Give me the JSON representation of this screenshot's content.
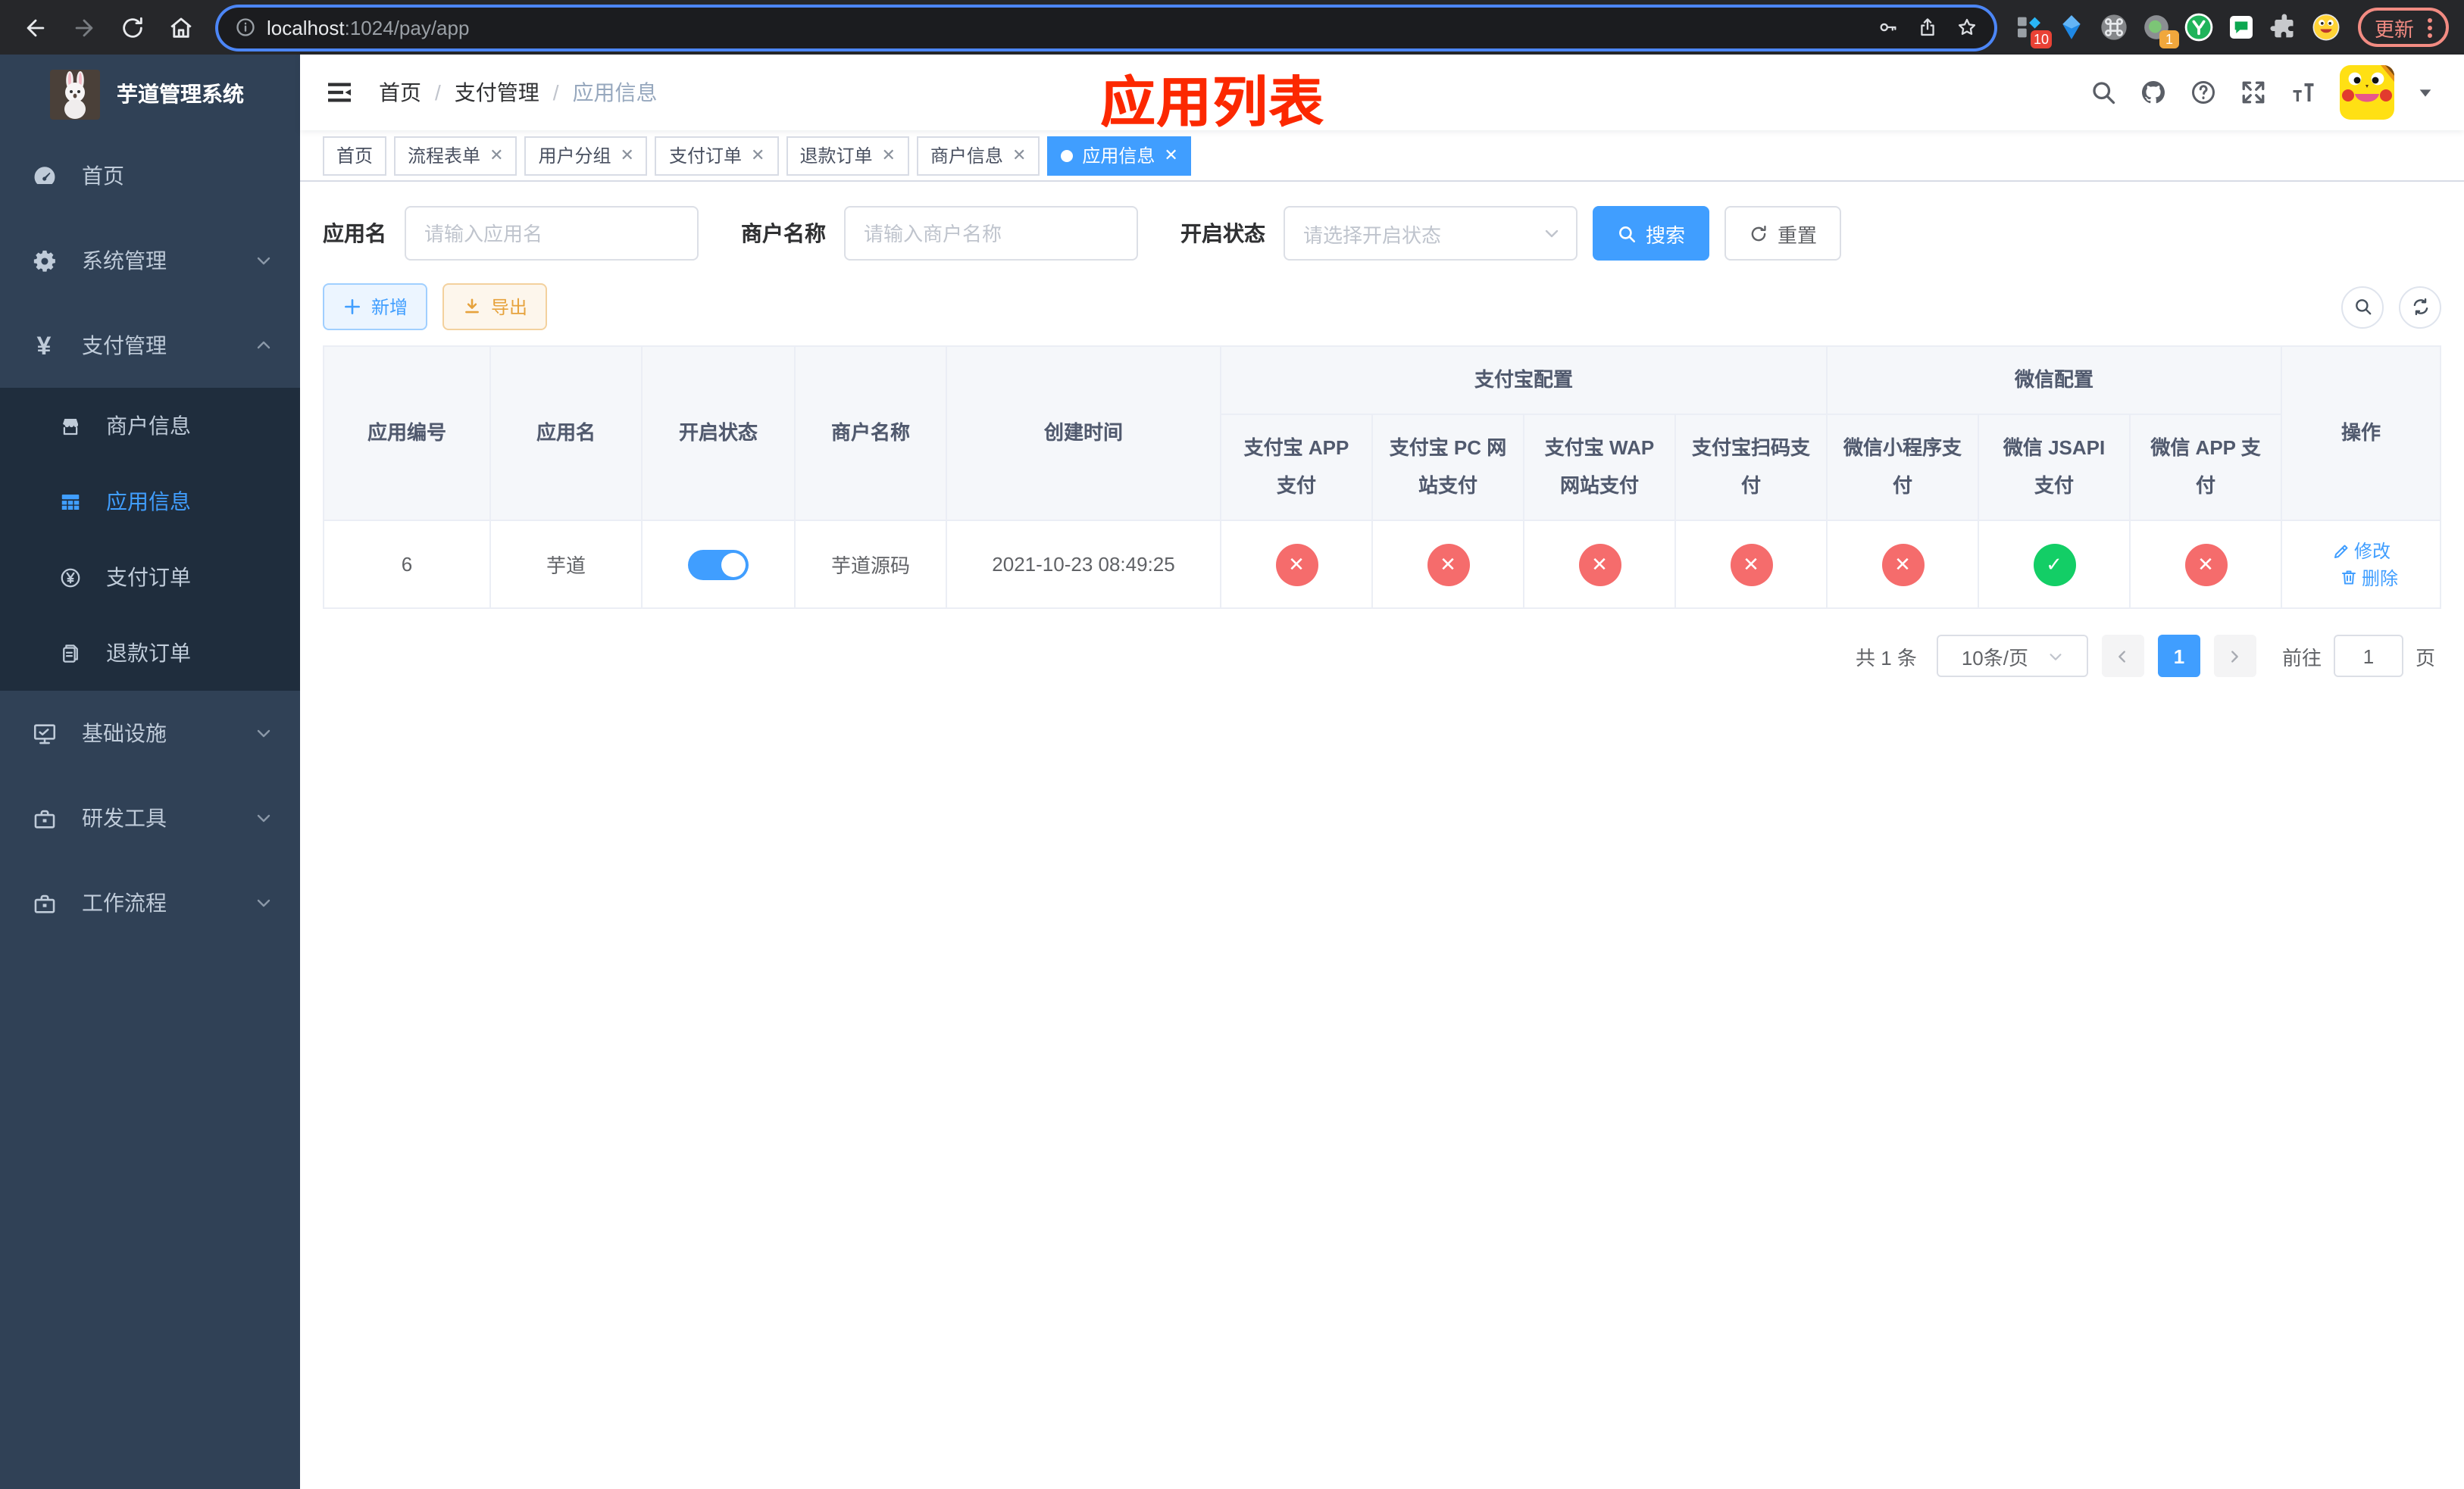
{
  "browser": {
    "url_host": "localhost",
    "url_path": ":1024/pay/app",
    "update_label": "更新",
    "ext_badge_1": "10",
    "ext_badge_2": "1"
  },
  "sidebar": {
    "title": "芋道管理系统",
    "items": [
      {
        "label": "首页"
      },
      {
        "label": "系统管理"
      },
      {
        "label": "支付管理"
      },
      {
        "label": "商户信息"
      },
      {
        "label": "应用信息"
      },
      {
        "label": "支付订单"
      },
      {
        "label": "退款订单"
      },
      {
        "label": "基础设施"
      },
      {
        "label": "研发工具"
      },
      {
        "label": "工作流程"
      }
    ]
  },
  "header": {
    "breadcrumb": [
      "首页",
      "支付管理",
      "应用信息"
    ],
    "page_title": "应用列表"
  },
  "tabs": [
    {
      "label": "首页",
      "closable": false,
      "active": false
    },
    {
      "label": "流程表单",
      "closable": true,
      "active": false
    },
    {
      "label": "用户分组",
      "closable": true,
      "active": false
    },
    {
      "label": "支付订单",
      "closable": true,
      "active": false
    },
    {
      "label": "退款订单",
      "closable": true,
      "active": false
    },
    {
      "label": "商户信息",
      "closable": true,
      "active": false
    },
    {
      "label": "应用信息",
      "closable": true,
      "active": true
    }
  ],
  "filters": {
    "app_name_label": "应用名",
    "app_name_placeholder": "请输入应用名",
    "merchant_label": "商户名称",
    "merchant_placeholder": "请输入商户名称",
    "status_label": "开启状态",
    "status_placeholder": "请选择开启状态",
    "search_label": "搜索",
    "reset_label": "重置"
  },
  "toolbar": {
    "add_label": "新增",
    "export_label": "导出"
  },
  "table": {
    "headers": {
      "app_id": "应用编号",
      "app_name": "应用名",
      "open_status": "开启状态",
      "merchant_name": "商户名称",
      "create_time": "创建时间",
      "alipay_group": "支付宝配置",
      "wechat_group": "微信配置",
      "actions": "操作",
      "sub": [
        "支付宝 APP 支付",
        "支付宝 PC 网站支付",
        "支付宝 WAP 网站支付",
        "支付宝扫码支付",
        "微信小程序支付",
        "微信 JSAPI 支付",
        "微信 APP 支付"
      ]
    },
    "row": {
      "app_id": "6",
      "app_name": "芋道",
      "enabled": "on",
      "merchant_name": "芋道源码",
      "create_time": "2021-10-23 08:49:25",
      "statuses": [
        "fail",
        "fail",
        "fail",
        "fail",
        "fail",
        "ok",
        "fail"
      ],
      "edit_label": "修改",
      "delete_label": "删除"
    }
  },
  "pagination": {
    "total": "共 1 条",
    "page_size": "10条/页",
    "page": "1",
    "goto_label": "前往",
    "goto_value": "1",
    "page_unit": "页"
  }
}
